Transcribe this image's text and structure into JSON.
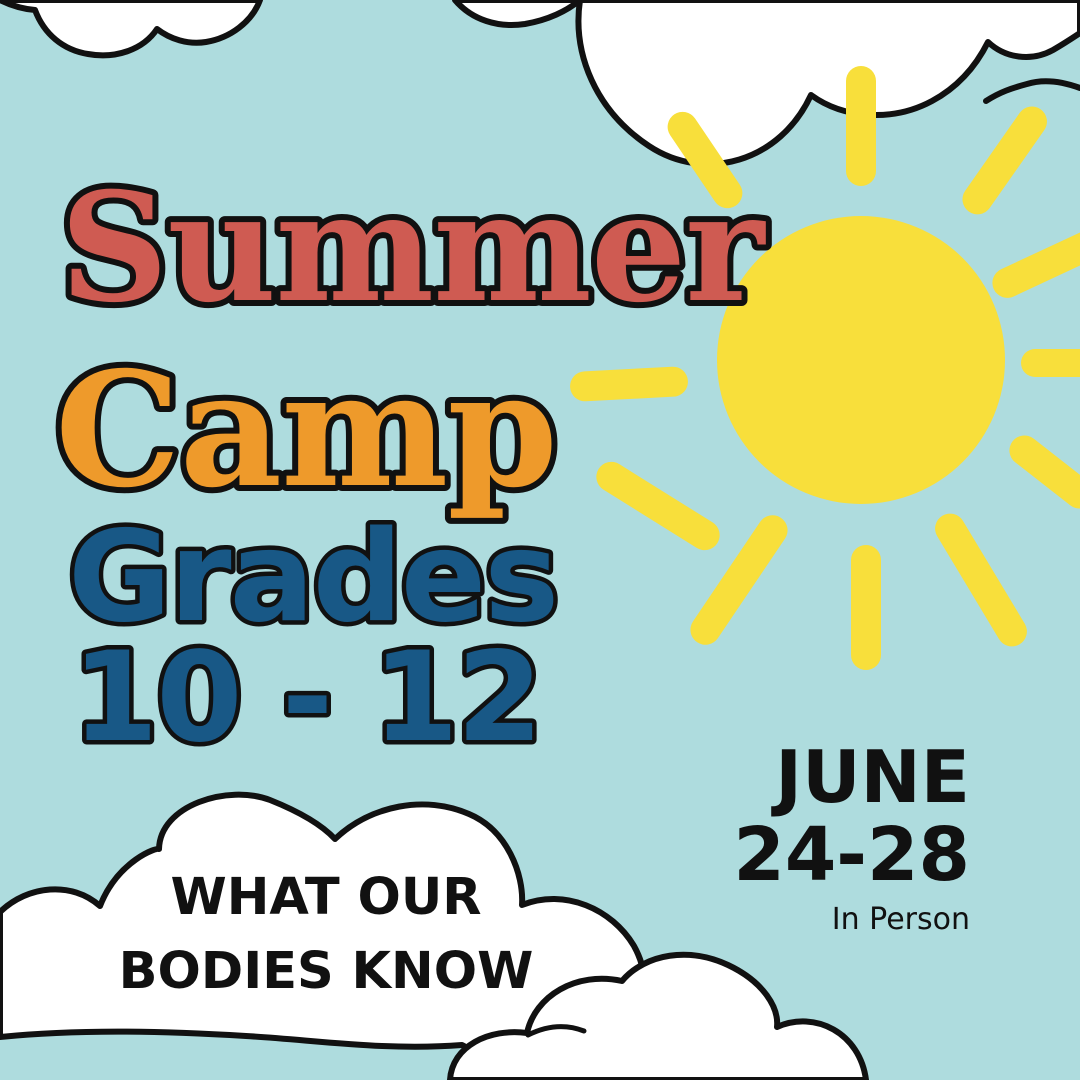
{
  "headline": {
    "line1": "Summer",
    "line2": "Camp"
  },
  "grades": {
    "line1": "Grades",
    "line2": "10 - 12"
  },
  "event": {
    "month": "JUNE",
    "days": "24-28",
    "format": "In Person"
  },
  "cloud_message": {
    "line1": "WHAT OUR",
    "line2": "BODIES KNOW"
  },
  "colors": {
    "background": "#aedcde",
    "summer": "#cf5b52",
    "camp": "#ee9a2b",
    "grades": "#185886",
    "sun": "#f8df3b",
    "cloud": "#ffffff",
    "outline": "#111111"
  }
}
